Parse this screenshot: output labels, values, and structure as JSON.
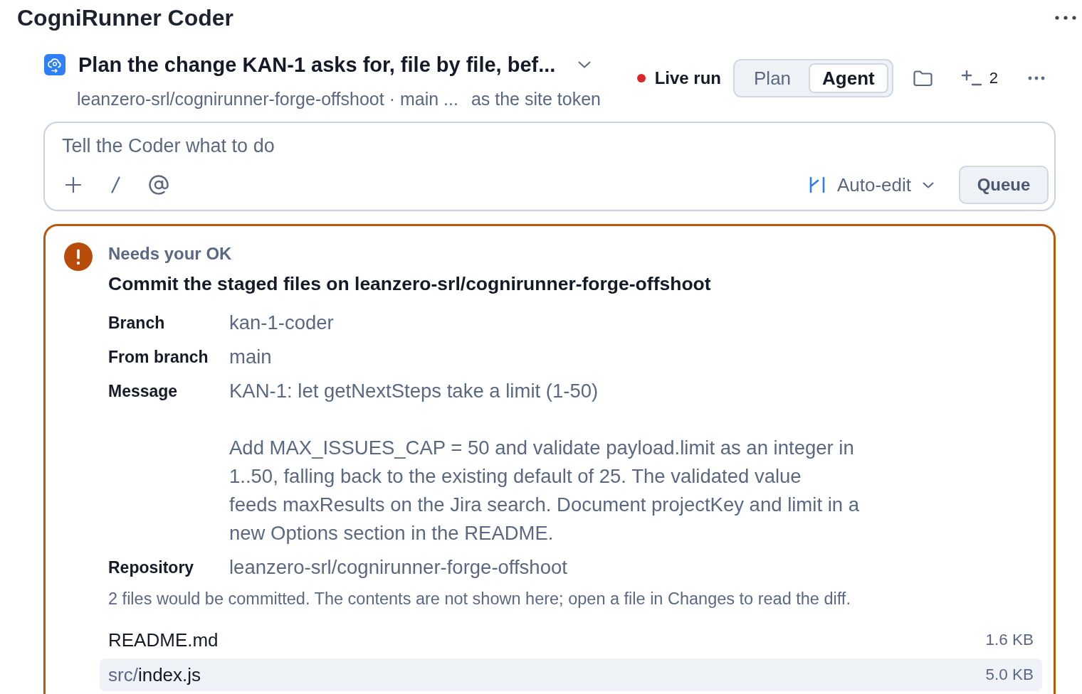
{
  "app": {
    "title": "CogniRunner Coder"
  },
  "task": {
    "title": "Plan the change KAN-1 asks for, file by file, bef...",
    "repo_line": "leanzero-srl/cognirunner-forge-offshoot · main ...",
    "note": "as the site token"
  },
  "run_status": {
    "label": "Live run",
    "live": true
  },
  "mode_switch": [
    {
      "label": "Plan",
      "selected": false
    },
    {
      "label": "Agent",
      "selected": true
    }
  ],
  "toolbar": {
    "count": "2"
  },
  "composer": {
    "placeholder": "Tell the Coder what to do",
    "edit_mode": "Auto-edit",
    "submit": "Queue"
  },
  "approval": {
    "status": "Needs your OK",
    "title": "Commit the staged files on leanzero-srl/cognirunner-forge-offshoot",
    "details": [
      {
        "label": "Branch",
        "value": "kan-1-coder"
      },
      {
        "label": "From branch",
        "value": "main"
      },
      {
        "label": "Message",
        "value": "KAN-1: let getNextSteps take a limit (1-50)\n\nAdd MAX_ISSUES_CAP = 50 and validate payload.limit as an integer in\n1..50, falling back to the existing default of 25. The validated value\nfeeds maxResults on the Jira search. Document projectKey and limit in a\nnew Options section in the README."
      },
      {
        "label": "Repository",
        "value": "leanzero-srl/cognirunner-forge-offshoot"
      }
    ],
    "note": "2 files would be committed. The contents are not shown here; open a file in Changes to read the diff.",
    "files": [
      {
        "name": "README.md",
        "size": "1.6 KB",
        "selected": false
      },
      {
        "dir": "src/",
        "name": "index.js",
        "size": "5.0 KB",
        "selected": true
      }
    ]
  }
}
